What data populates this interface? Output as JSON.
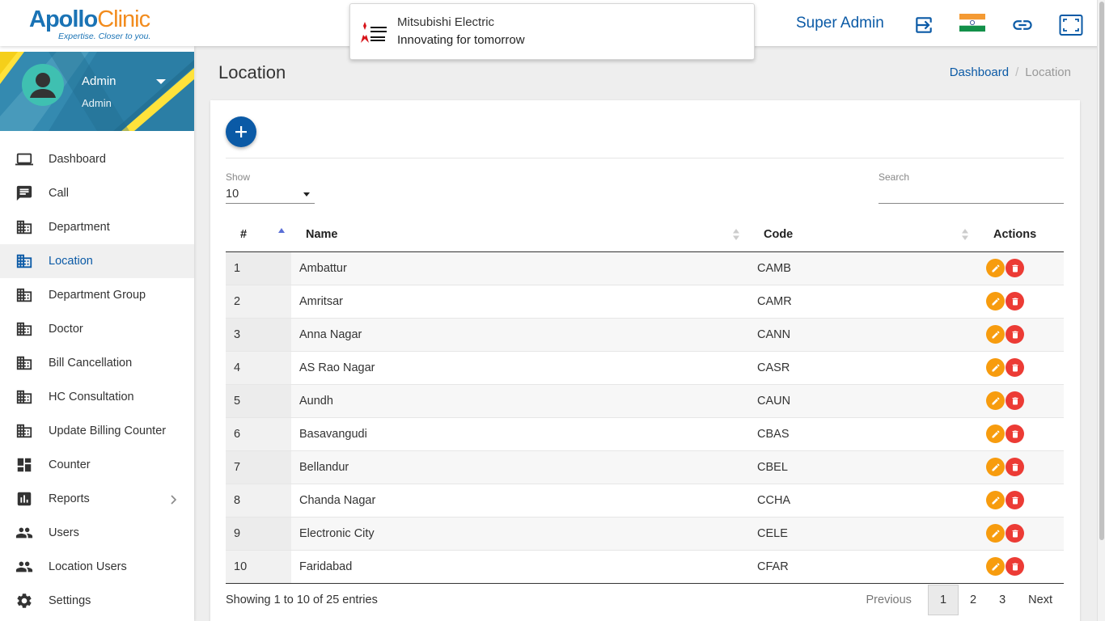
{
  "app": {
    "logo_main": "Apollo",
    "logo_clinic": "Clinic",
    "logo_tagline": "Expertise. Closer to you."
  },
  "notification": {
    "logo_text": "MITSUBISHI ELECTRIC",
    "title": "Mitsubishi Electric",
    "subtitle": "Innovating for tomorrow"
  },
  "header": {
    "user_label": "Super Admin",
    "icons": [
      "login-icon",
      "india-flag-icon",
      "link-icon",
      "fullscreen-icon"
    ]
  },
  "profile": {
    "name": "Admin",
    "role": "Admin"
  },
  "sidebar": {
    "items": [
      {
        "label": "Dashboard",
        "icon": "laptop-icon"
      },
      {
        "label": "Call",
        "icon": "message-icon"
      },
      {
        "label": "Department",
        "icon": "building-icon"
      },
      {
        "label": "Location",
        "icon": "building-icon",
        "active": true
      },
      {
        "label": "Department Group",
        "icon": "building-icon"
      },
      {
        "label": "Doctor",
        "icon": "building-icon"
      },
      {
        "label": "Bill Cancellation",
        "icon": "building-icon"
      },
      {
        "label": "HC Consultation",
        "icon": "building-icon"
      },
      {
        "label": "Update Billing Counter",
        "icon": "building-icon"
      },
      {
        "label": "Counter",
        "icon": "dashboard-icon"
      },
      {
        "label": "Reports",
        "icon": "chart-icon",
        "has_submenu": true
      },
      {
        "label": "Users",
        "icon": "people-icon"
      },
      {
        "label": "Location Users",
        "icon": "people-icon"
      },
      {
        "label": "Settings",
        "icon": "gear-icon"
      }
    ]
  },
  "page": {
    "title": "Location",
    "breadcrumb": {
      "home": "Dashboard",
      "current": "Location"
    }
  },
  "table_controls": {
    "show_label": "Show",
    "show_value": "10",
    "search_label": "Search",
    "search_value": ""
  },
  "table": {
    "headers": {
      "num": "#",
      "name": "Name",
      "code": "Code",
      "actions": "Actions"
    },
    "rows": [
      {
        "num": "1",
        "name": "Ambattur",
        "code": "CAMB"
      },
      {
        "num": "2",
        "name": "Amritsar",
        "code": "CAMR"
      },
      {
        "num": "3",
        "name": "Anna Nagar",
        "code": "CANN"
      },
      {
        "num": "4",
        "name": "AS Rao Nagar",
        "code": "CASR"
      },
      {
        "num": "5",
        "name": "Aundh",
        "code": "CAUN"
      },
      {
        "num": "6",
        "name": "Basavangudi",
        "code": "CBAS"
      },
      {
        "num": "7",
        "name": "Bellandur",
        "code": "CBEL"
      },
      {
        "num": "8",
        "name": "Chanda Nagar",
        "code": "CCHA"
      },
      {
        "num": "9",
        "name": "Electronic City",
        "code": "CELE"
      },
      {
        "num": "10",
        "name": "Faridabad",
        "code": "CFAR"
      }
    ]
  },
  "footer": {
    "entries_text": "Showing 1 to 10 of 25 entries",
    "pagination": {
      "previous": "Previous",
      "pages": [
        "1",
        "2",
        "3"
      ],
      "next": "Next",
      "current": "1"
    }
  },
  "colors": {
    "brand_blue": "#0b5aa6",
    "edit_orange": "#f79c0e",
    "delete_red": "#ec3b35"
  }
}
